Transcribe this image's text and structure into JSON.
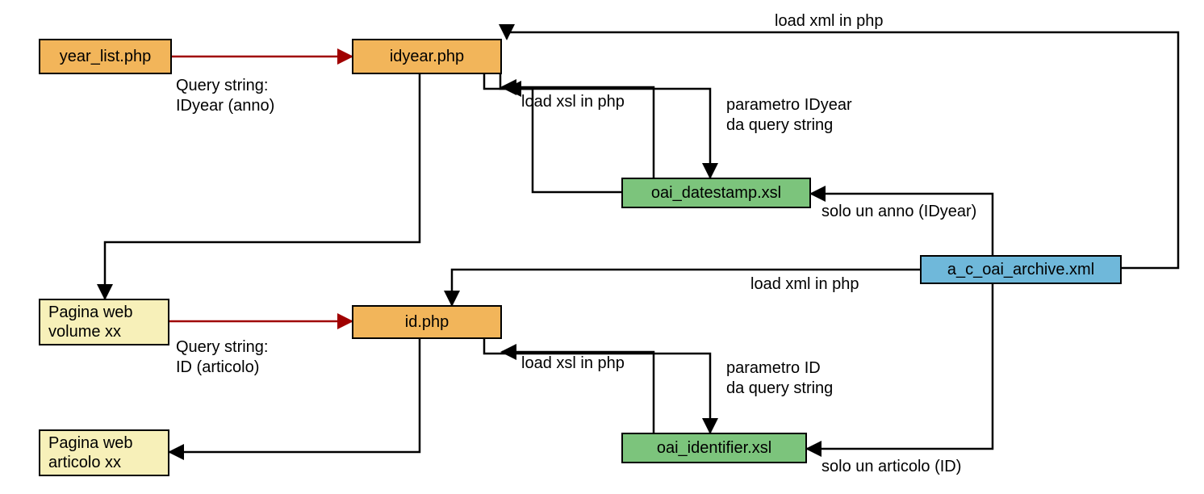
{
  "nodes": {
    "year_list": "year_list.php",
    "idyear": "idyear.php",
    "oai_datestamp": "oai_datestamp.xsl",
    "archive": "a_c_oai_archive.xml",
    "pagina_vol": "Pagina web\nvolume xx",
    "id": "id.php",
    "oai_identifier": "oai_identifier.xsl",
    "pagina_art": "Pagina web\narticolo xx"
  },
  "labels": {
    "qs_idyear": "Query string:\nIDyear (anno)",
    "load_xml_top": "load xml in php",
    "load_xsl_top": "load xsl in php",
    "param_idyear": "parametro IDyear\nda query string",
    "solo_anno": "solo un anno (IDyear)",
    "load_xml_mid": "load xml in php",
    "qs_id": "Query string:\nID (articolo)",
    "load_xsl_bot": "load xsl in php",
    "param_id": "parametro ID\nda query string",
    "solo_articolo": "solo un articolo (ID)"
  }
}
